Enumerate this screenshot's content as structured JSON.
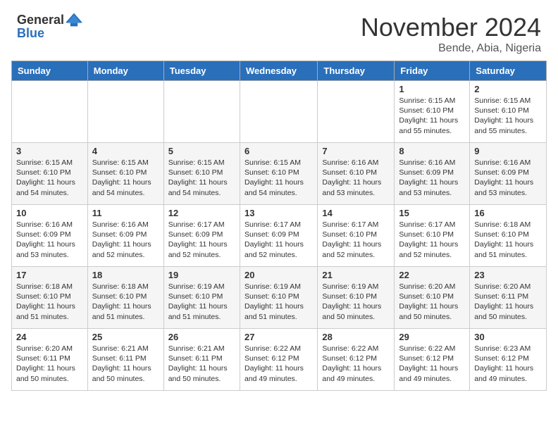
{
  "logo": {
    "general": "General",
    "blue": "Blue"
  },
  "title": "November 2024",
  "location": "Bende, Abia, Nigeria",
  "weekdays": [
    "Sunday",
    "Monday",
    "Tuesday",
    "Wednesday",
    "Thursday",
    "Friday",
    "Saturday"
  ],
  "weeks": [
    [
      {
        "day": "",
        "info": ""
      },
      {
        "day": "",
        "info": ""
      },
      {
        "day": "",
        "info": ""
      },
      {
        "day": "",
        "info": ""
      },
      {
        "day": "",
        "info": ""
      },
      {
        "day": "1",
        "info": "Sunrise: 6:15 AM\nSunset: 6:10 PM\nDaylight: 11 hours and 55 minutes."
      },
      {
        "day": "2",
        "info": "Sunrise: 6:15 AM\nSunset: 6:10 PM\nDaylight: 11 hours and 55 minutes."
      }
    ],
    [
      {
        "day": "3",
        "info": "Sunrise: 6:15 AM\nSunset: 6:10 PM\nDaylight: 11 hours and 54 minutes."
      },
      {
        "day": "4",
        "info": "Sunrise: 6:15 AM\nSunset: 6:10 PM\nDaylight: 11 hours and 54 minutes."
      },
      {
        "day": "5",
        "info": "Sunrise: 6:15 AM\nSunset: 6:10 PM\nDaylight: 11 hours and 54 minutes."
      },
      {
        "day": "6",
        "info": "Sunrise: 6:15 AM\nSunset: 6:10 PM\nDaylight: 11 hours and 54 minutes."
      },
      {
        "day": "7",
        "info": "Sunrise: 6:16 AM\nSunset: 6:10 PM\nDaylight: 11 hours and 53 minutes."
      },
      {
        "day": "8",
        "info": "Sunrise: 6:16 AM\nSunset: 6:09 PM\nDaylight: 11 hours and 53 minutes."
      },
      {
        "day": "9",
        "info": "Sunrise: 6:16 AM\nSunset: 6:09 PM\nDaylight: 11 hours and 53 minutes."
      }
    ],
    [
      {
        "day": "10",
        "info": "Sunrise: 6:16 AM\nSunset: 6:09 PM\nDaylight: 11 hours and 53 minutes."
      },
      {
        "day": "11",
        "info": "Sunrise: 6:16 AM\nSunset: 6:09 PM\nDaylight: 11 hours and 52 minutes."
      },
      {
        "day": "12",
        "info": "Sunrise: 6:17 AM\nSunset: 6:09 PM\nDaylight: 11 hours and 52 minutes."
      },
      {
        "day": "13",
        "info": "Sunrise: 6:17 AM\nSunset: 6:09 PM\nDaylight: 11 hours and 52 minutes."
      },
      {
        "day": "14",
        "info": "Sunrise: 6:17 AM\nSunset: 6:10 PM\nDaylight: 11 hours and 52 minutes."
      },
      {
        "day": "15",
        "info": "Sunrise: 6:17 AM\nSunset: 6:10 PM\nDaylight: 11 hours and 52 minutes."
      },
      {
        "day": "16",
        "info": "Sunrise: 6:18 AM\nSunset: 6:10 PM\nDaylight: 11 hours and 51 minutes."
      }
    ],
    [
      {
        "day": "17",
        "info": "Sunrise: 6:18 AM\nSunset: 6:10 PM\nDaylight: 11 hours and 51 minutes."
      },
      {
        "day": "18",
        "info": "Sunrise: 6:18 AM\nSunset: 6:10 PM\nDaylight: 11 hours and 51 minutes."
      },
      {
        "day": "19",
        "info": "Sunrise: 6:19 AM\nSunset: 6:10 PM\nDaylight: 11 hours and 51 minutes."
      },
      {
        "day": "20",
        "info": "Sunrise: 6:19 AM\nSunset: 6:10 PM\nDaylight: 11 hours and 51 minutes."
      },
      {
        "day": "21",
        "info": "Sunrise: 6:19 AM\nSunset: 6:10 PM\nDaylight: 11 hours and 50 minutes."
      },
      {
        "day": "22",
        "info": "Sunrise: 6:20 AM\nSunset: 6:10 PM\nDaylight: 11 hours and 50 minutes."
      },
      {
        "day": "23",
        "info": "Sunrise: 6:20 AM\nSunset: 6:11 PM\nDaylight: 11 hours and 50 minutes."
      }
    ],
    [
      {
        "day": "24",
        "info": "Sunrise: 6:20 AM\nSunset: 6:11 PM\nDaylight: 11 hours and 50 minutes."
      },
      {
        "day": "25",
        "info": "Sunrise: 6:21 AM\nSunset: 6:11 PM\nDaylight: 11 hours and 50 minutes."
      },
      {
        "day": "26",
        "info": "Sunrise: 6:21 AM\nSunset: 6:11 PM\nDaylight: 11 hours and 50 minutes."
      },
      {
        "day": "27",
        "info": "Sunrise: 6:22 AM\nSunset: 6:12 PM\nDaylight: 11 hours and 49 minutes."
      },
      {
        "day": "28",
        "info": "Sunrise: 6:22 AM\nSunset: 6:12 PM\nDaylight: 11 hours and 49 minutes."
      },
      {
        "day": "29",
        "info": "Sunrise: 6:22 AM\nSunset: 6:12 PM\nDaylight: 11 hours and 49 minutes."
      },
      {
        "day": "30",
        "info": "Sunrise: 6:23 AM\nSunset: 6:12 PM\nDaylight: 11 hours and 49 minutes."
      }
    ]
  ]
}
